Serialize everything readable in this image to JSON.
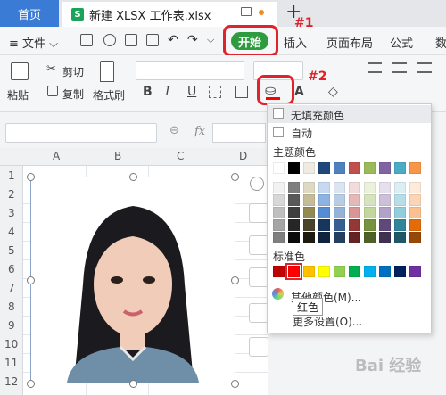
{
  "tabs": {
    "home": "首页",
    "file": "新建 XLSX 工作表.xlsx",
    "add": "+"
  },
  "menubar": {
    "file_menu": "≡ 文件 ⌵",
    "items": [
      "开始",
      "插入",
      "页面布局",
      "公式",
      "数"
    ]
  },
  "annotations": {
    "label1": "#1",
    "label2": "#2"
  },
  "ribbon": {
    "paste": "粘贴",
    "cut": "剪切",
    "copy": "复制",
    "format_painter": "格式刷",
    "bold": "B",
    "italic": "I",
    "underline": "U",
    "font_color": "A"
  },
  "formula_bar": {
    "fx": "fx",
    "zoom": "⊖"
  },
  "grid": {
    "columns": [
      "A",
      "B",
      "C",
      "D"
    ],
    "rows": [
      "1",
      "2",
      "3",
      "4",
      "5",
      "6",
      "7",
      "8",
      "9",
      "10",
      "11",
      "12"
    ]
  },
  "fill_menu": {
    "no_fill": "无填充颜色",
    "auto": "自动",
    "theme_colors": "主题颜色",
    "standard_colors": "标准色",
    "more_colors": "其他颜色(M)...",
    "more_settings": "更多设置(O)...",
    "tooltip": "红色",
    "theme_top": [
      "#ffffff",
      "#000000",
      "#e7e6e6",
      "#44546a",
      "#4472c4",
      "#ed7d31",
      "#a5a5a5",
      "#ffc000",
      "#5b9bd5",
      "#70ad47"
    ],
    "theme_top_actual": [
      "#ffffff",
      "#000000",
      "#eeece1",
      "#1f497d",
      "#4f81bd",
      "#c0504d",
      "#9bbb59",
      "#8064a2",
      "#4bacc6",
      "#f79646"
    ],
    "theme_tints": [
      [
        "#f2f2f2",
        "#7f7f7f",
        "#ddd9c3",
        "#c6d9f0",
        "#dbe5f1",
        "#f2dcdb",
        "#ebf1dd",
        "#e5e0ec",
        "#dbeef3",
        "#fdeada"
      ],
      [
        "#d8d8d8",
        "#595959",
        "#c4bd97",
        "#8db3e2",
        "#b8cce4",
        "#e5b9b7",
        "#d7e3bc",
        "#ccc1d9",
        "#b7dde8",
        "#fbd5b5"
      ],
      [
        "#bfbfbf",
        "#3f3f3f",
        "#938953",
        "#548dd4",
        "#95b3d7",
        "#d99694",
        "#c3d69b",
        "#b2a2c7",
        "#92cddc",
        "#fac08f"
      ],
      [
        "#a5a5a5",
        "#262626",
        "#494429",
        "#17365d",
        "#366092",
        "#953734",
        "#76923c",
        "#5f497a",
        "#31859b",
        "#e36c09"
      ],
      [
        "#7f7f7f",
        "#0c0c0c",
        "#1d1b10",
        "#0f243e",
        "#244061",
        "#632423",
        "#4f6128",
        "#3f3151",
        "#205867",
        "#974806"
      ]
    ],
    "standard": [
      "#c00000",
      "#ff0000",
      "#ffc000",
      "#ffff00",
      "#92d050",
      "#00b050",
      "#00b0f0",
      "#0070c0",
      "#002060",
      "#7030a0"
    ]
  },
  "watermark": "Bai 经验"
}
